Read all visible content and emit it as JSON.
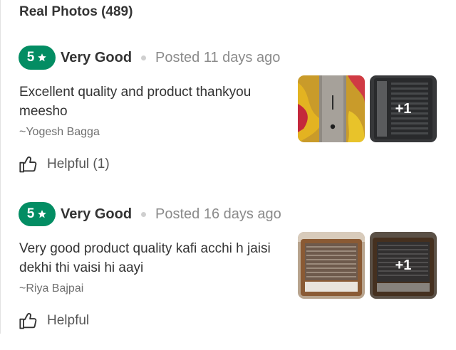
{
  "section_title": "Real Photos (489)",
  "reviews": [
    {
      "rating": "5",
      "rating_label": "Very Good",
      "posted": "Posted 11 days ago",
      "text": "Excellent quality and product thankyou meesho",
      "reviewer": "~Yogesh Bagga",
      "helpful": "Helpful (1)",
      "more_photos": "+1"
    },
    {
      "rating": "5",
      "rating_label": "Very Good",
      "posted": "Posted 16 days ago",
      "text": "Very good product quality kafi acchi h jaisi dekhi thi vaisi hi aayi",
      "reviewer": "~Riya Bajpai",
      "helpful": "Helpful",
      "more_photos": "+1"
    }
  ],
  "colors": {
    "badge_green": "#038d63",
    "text_dark": "#333333",
    "text_muted": "#8b8b8b"
  },
  "icons": [
    "star-icon",
    "thumbs-up-icon"
  ]
}
